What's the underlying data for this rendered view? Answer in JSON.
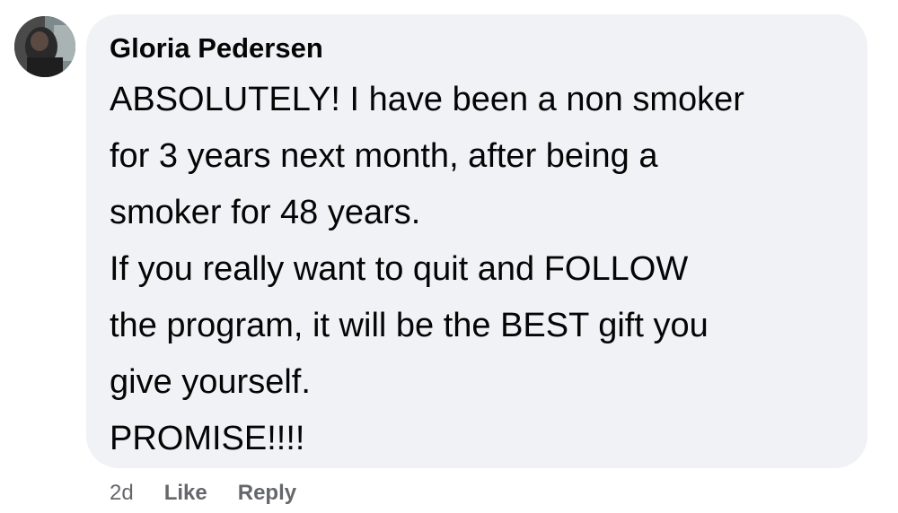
{
  "comment": {
    "author": "Gloria Pedersen",
    "lines": [
      "ABSOLUTELY! I have been a non smoker",
      "for 3 years next month, after being a",
      "smoker for 48 years.",
      "If you really want to quit and FOLLOW",
      "the program, it will be the BEST gift you",
      "give yourself.",
      "PROMISE!!!!"
    ],
    "timestamp": "2d",
    "like_label": "Like",
    "reply_label": "Reply"
  },
  "colors": {
    "bubble_bg": "#f0f2f5",
    "text": "#050505",
    "meta": "#65676b"
  }
}
